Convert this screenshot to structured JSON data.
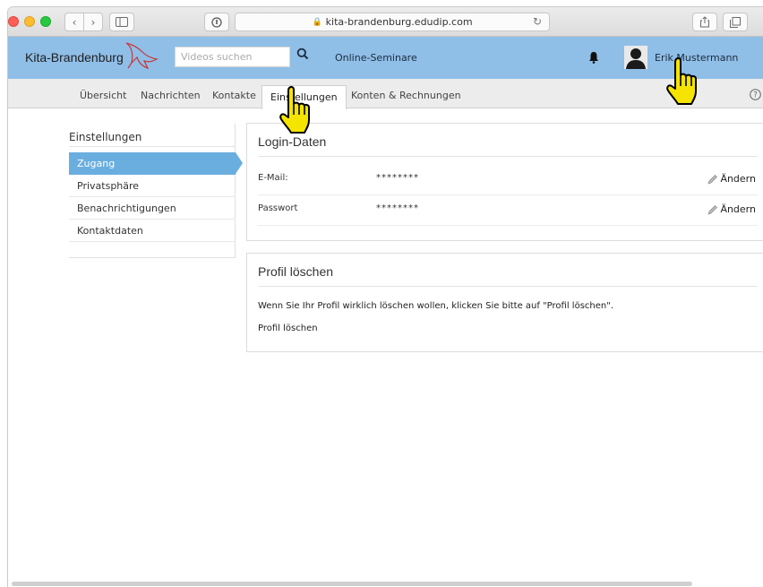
{
  "browser": {
    "url": "kita-brandenburg.edudip.com"
  },
  "header": {
    "brand": "Kita-Brandenburg",
    "search_placeholder": "Videos suchen",
    "nav_seminare": "Online-Seminare",
    "user_name": "Erik Mustermann"
  },
  "tabs": [
    {
      "label": "Übersicht"
    },
    {
      "label": "Nachrichten"
    },
    {
      "label": "Kontakte"
    },
    {
      "label": "Einstellungen"
    },
    {
      "label": "Konten & Rechnungen"
    }
  ],
  "sidebar": {
    "title": "Einstellungen",
    "items": [
      {
        "label": "Zugang"
      },
      {
        "label": "Privatsphäre"
      },
      {
        "label": "Benachrichtigungen"
      },
      {
        "label": "Kontaktdaten"
      }
    ]
  },
  "login_panel": {
    "title": "Login-Daten",
    "rows": [
      {
        "label": "E-Mail:",
        "value": "********",
        "action": "Ändern"
      },
      {
        "label": "Passwort",
        "value": "********",
        "action": "Ändern"
      }
    ]
  },
  "delete_panel": {
    "title": "Profil löschen",
    "text": "Wenn Sie Ihr Profil wirklich löschen wollen, klicken Sie bitte auf \"Profil löschen\".",
    "link": "Profil löschen"
  },
  "colors": {
    "header_bg": "#8fbee7",
    "active_item": "#6aaedf",
    "cursor_fill": "#f5e400"
  }
}
